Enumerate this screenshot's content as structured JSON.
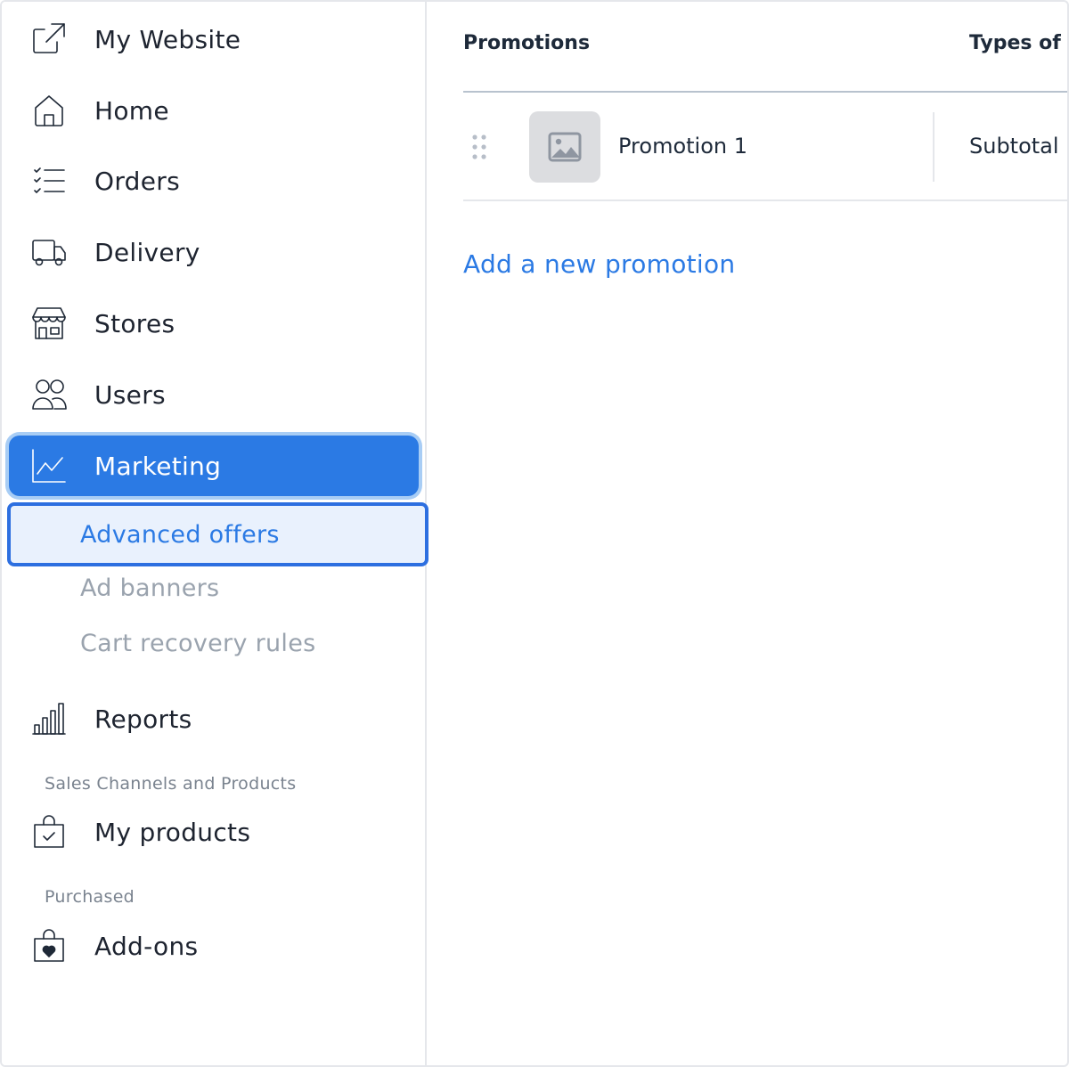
{
  "sidebar": {
    "items": [
      {
        "label": "My Website",
        "icon": "external-link-icon"
      },
      {
        "label": "Home",
        "icon": "home-icon"
      },
      {
        "label": "Orders",
        "icon": "list-icon"
      },
      {
        "label": "Delivery",
        "icon": "truck-icon"
      },
      {
        "label": "Stores",
        "icon": "store-icon"
      },
      {
        "label": "Users",
        "icon": "users-icon"
      },
      {
        "label": "Marketing",
        "icon": "chart-line-icon",
        "active": true
      },
      {
        "label": "Reports",
        "icon": "bar-chart-icon"
      }
    ],
    "marketing_sub": [
      {
        "label": "Advanced offers",
        "selected": true
      },
      {
        "label": "Ad banners"
      },
      {
        "label": "Cart recovery rules"
      }
    ],
    "section_sales": "Sales Channels and Products",
    "my_products": {
      "label": "My products",
      "icon": "shopping-bag-check-icon"
    },
    "section_purchased": "Purchased",
    "addons": {
      "label": "Add-ons",
      "icon": "bag-heart-icon"
    }
  },
  "main": {
    "columns": {
      "promotions": "Promotions",
      "types": "Types of p"
    },
    "rows": [
      {
        "name": "Promotion 1",
        "type": "Subtotal",
        "thumb_icon": "image-placeholder-icon"
      }
    ],
    "add_link": "Add a new promotion"
  },
  "colors": {
    "accent": "#2b7ae4",
    "active_ring": "#a8cdf5",
    "selected_bg": "#e9f1fd",
    "muted_text": "#9aa3ae"
  }
}
